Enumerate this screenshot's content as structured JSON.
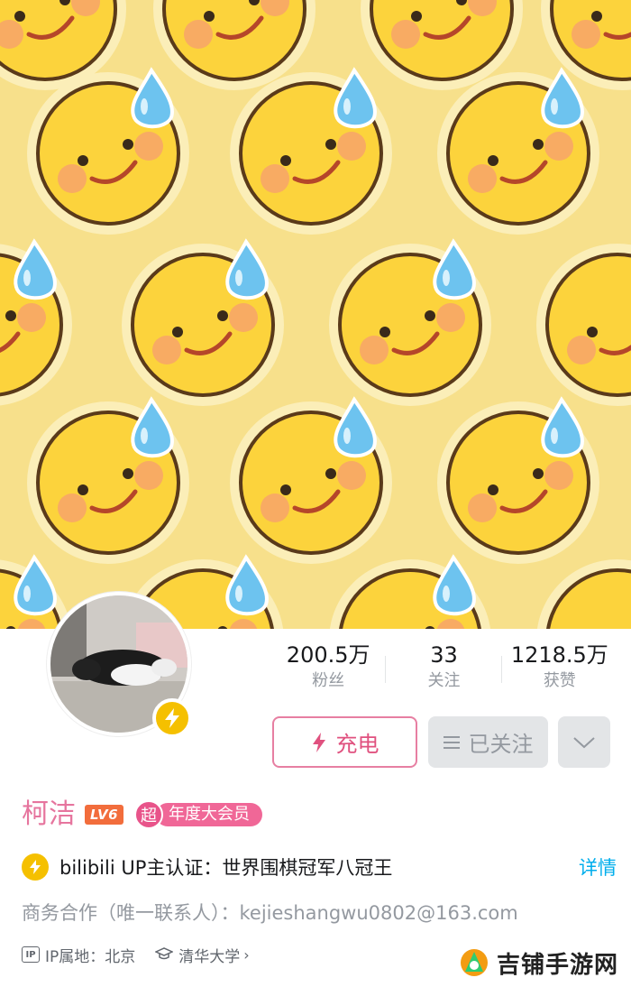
{
  "banner": {
    "pattern": "sweat-smile-emoji",
    "background_color": "#f7e08b",
    "face_color": "#fcd33c",
    "drop_color": "#6dc3ef"
  },
  "avatar": {
    "description_icon": "cat-avatar",
    "badge_icon": "lightning-icon"
  },
  "stats": [
    {
      "value": "200.5万",
      "label": "粉丝"
    },
    {
      "value": "33",
      "label": "关注"
    },
    {
      "value": "1218.5万",
      "label": "获赞"
    }
  ],
  "buttons": {
    "charge": "充电",
    "follow": "已关注"
  },
  "user": {
    "name": "柯洁",
    "level": "LV6",
    "vip_badge": "超",
    "vip_text": "年度大会员"
  },
  "certification": {
    "text": "bilibili UP主认证：世界围棋冠军八冠王",
    "detail": "详情"
  },
  "business": "商务合作（唯一联系人）：kejieshangwu0802@163.com",
  "meta": {
    "ip_label": "IP属地：北京",
    "school": "清华大学"
  },
  "watermark": "吉铺手游网",
  "colors": {
    "accent_pink": "#e6759e",
    "link_blue": "#00aeec",
    "gold": "#f5c000"
  }
}
